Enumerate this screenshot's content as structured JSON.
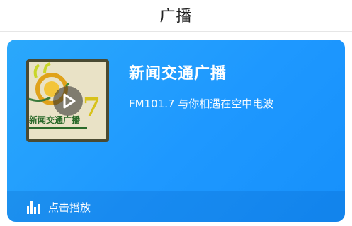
{
  "header": {
    "title": "广播"
  },
  "station": {
    "name": "新闻交通广播",
    "description": "FM101.7 与你相遇在空中电波",
    "cover_logo_text": "新闻交通广播",
    "cover_logo_number": "7"
  },
  "footer": {
    "play_label": "点击播放"
  },
  "colors": {
    "card_gradient_start": "#2aa8fb",
    "card_gradient_end": "#1690fb",
    "text": "#ffffff",
    "header_text": "#222222"
  },
  "icons": {
    "play": "play-icon",
    "bars": "audio-bars-icon"
  }
}
